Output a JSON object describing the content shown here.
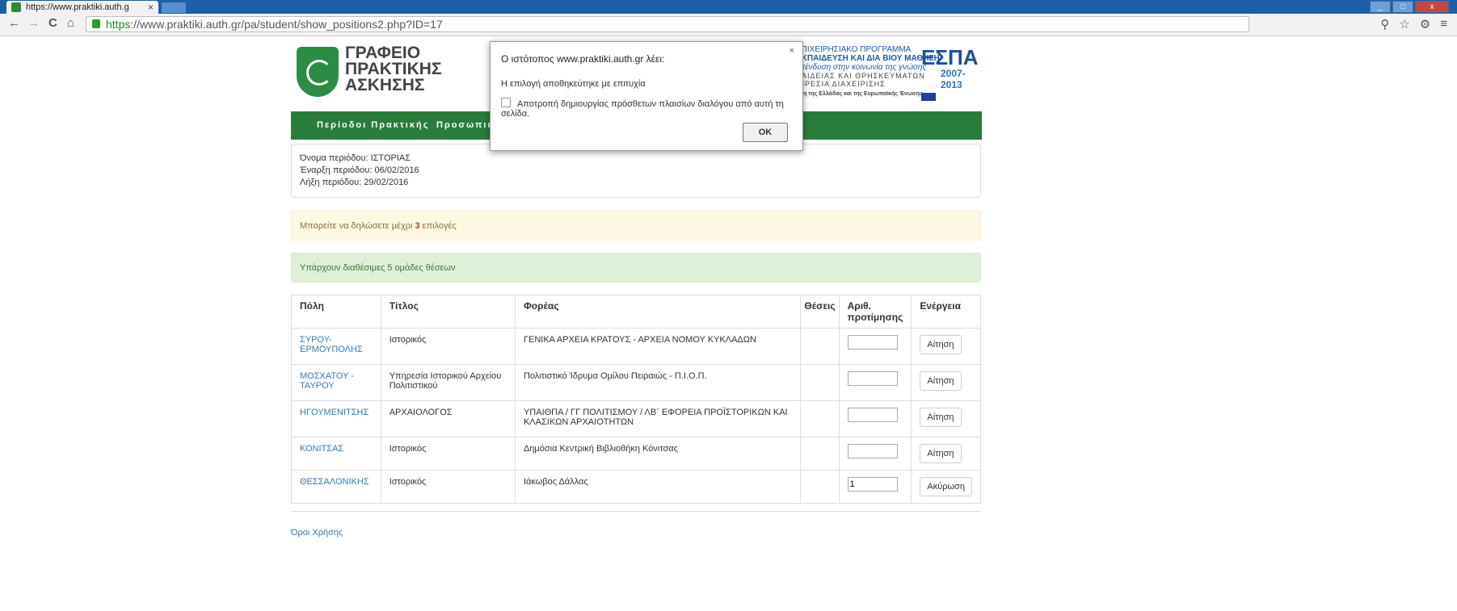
{
  "browser": {
    "tab_title": "https://www.praktiki.auth.g",
    "tab_close": "×",
    "url_https": "https",
    "url_rest": "://www.praktiki.auth.gr/pa/student/show_positions2.php?ID=17",
    "back": "←",
    "forward": "→",
    "reload": "C",
    "home": "⌂",
    "zoom": "⚲",
    "star": "☆",
    "settings": "⚙",
    "menu": "≡",
    "win_min": "_",
    "win_max": "□",
    "win_close": "x"
  },
  "logo": {
    "line1": "ΓΡΑΦΕΙΟ",
    "line2": "ΠΡΑΚΤΙΚΗΣ",
    "line3": "ΑΣΚΗΣΗΣ"
  },
  "sponsor": {
    "l1": "ΕΠΙΧΕΙΡΗΣΙΑΚΟ ΠΡΟΓΡΑΜΜΑ",
    "l2": "ΕΚΠΑΙΔΕΥΣΗ ΚΑΙ ΔΙΑ ΒΙΟΥ ΜΑΘΗΣΗ",
    "l3": "επένδυση στην κοινωνία της γνώσης",
    "l4": "ΚΑΙΔΕΙΑΣ ΚΑΙ ΘΡΗΣΚΕΥΜΑΤΩΝ",
    "l5": "ΙΗΡΕΣΙΑ ΔΙΑΧΕΙΡΙΣΗΣ",
    "l6": "ηση της Ελλάδας και της Ευρωπαϊκής Ένωσης",
    "espa": "ΕΣΠΑ",
    "espa_years": "2007-2013"
  },
  "menu": {
    "item1": "Περίοδοι Πρακτικής",
    "item2": "Προσωπικ"
  },
  "period": {
    "name": "Όνομα περιόδου: ΙΣΤΟΡΙΑΣ",
    "start": "Έναρξη περιόδου: 06/02/2016",
    "end": "Λήξη περιόδου: 29/02/2016"
  },
  "warning": {
    "prefix": "Μπορείτε να δηλώσετε μέχρι ",
    "count": "3",
    "suffix": " επιλογές"
  },
  "success": {
    "text": "Υπάρχουν διαθέσιμες 5 ομάδες θέσεων"
  },
  "table": {
    "headers": {
      "city": "Πόλη",
      "title": "Τίτλος",
      "org": "Φορέας",
      "seats": "Θέσεις",
      "rank": "Αριθ. προτίμησης",
      "action": "Ενέργεια"
    },
    "rows": [
      {
        "city": "ΣΥΡΟΥ-ΕΡΜΟΥΠΟΛΗΣ",
        "title": "Ιστορικός",
        "org": "ΓΕΝΙΚΑ ΑΡΧΕΙΑ ΚΡΑΤΟΥΣ - ΑΡΧΕΙΑ ΝΟΜΟΥ ΚΥΚΛΑΔΩΝ",
        "seats": "",
        "rank": "",
        "action": "Αίτηση"
      },
      {
        "city": "ΜΟΣΧΑΤΟΥ - ΤΑΥΡΟΥ",
        "title": "Υπηρεσία Ιστορικού Αρχείου Πολιτιστικού",
        "org": "Πολιτιστικό Ίδρυμα Ομίλου Πειραιώς - Π.Ι.Ο.Π.",
        "seats": "",
        "rank": "",
        "action": "Αίτηση"
      },
      {
        "city": "ΗΓΟΥΜΕΝΙΤΣΗΣ",
        "title": "ΑΡΧΑΙΟΛΟΓΟΣ",
        "org": "ΥΠΑΙΘΠΑ / ΓΓ ΠΟΛΙΤΙΣΜΟΥ / ΛΒ΄ ΕΦΟΡΕΙΑ ΠΡΟΪΣΤΟΡΙΚΩΝ ΚΑΙ ΚΛΑΣΙΚΩΝ ΑΡΧΑΙΟΤΗΤΩΝ",
        "seats": "",
        "rank": "",
        "action": "Αίτηση"
      },
      {
        "city": "ΚΟΝΙΤΣΑΣ",
        "title": "Ιστορικός",
        "org": "Δημόσια Κεντρική Βιβλιοθήκη Κόνιτσας",
        "seats": "",
        "rank": "",
        "action": "Αίτηση"
      },
      {
        "city": "ΘΕΣΣΑΛΟΝΙΚΗΣ",
        "title": "Ιστορικός",
        "org": "Ιάκωβος Δάλλας",
        "seats": "",
        "rank": "1",
        "action": "Ακύρωση"
      }
    ]
  },
  "footer": {
    "terms": "Όροι Χρήσης"
  },
  "dialog": {
    "title": "Ο ιστότοπος www.praktiki.auth.gr λέει:",
    "close": "×",
    "message": "Η επιλογή αποθηκεύτηκε με επιτυχία",
    "checkbox": "Αποτροπή δημιουργίας πρόσθετων πλαισίων διαλόγου από αυτή τη σελίδα.",
    "ok": "OK"
  }
}
